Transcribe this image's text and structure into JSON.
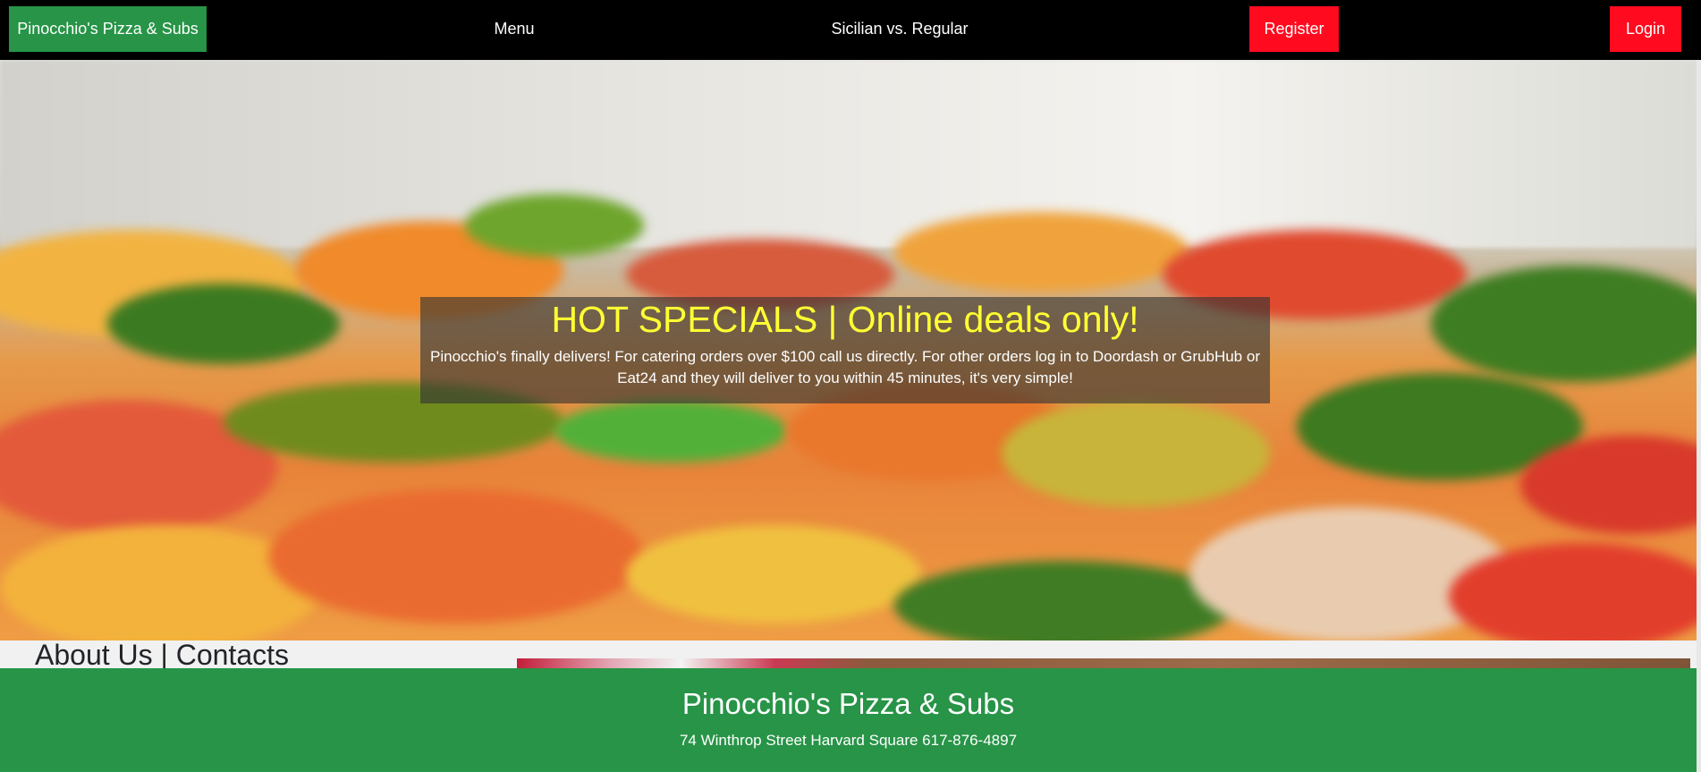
{
  "navbar": {
    "brand_label": "Pinocchio's Pizza & Subs",
    "menu_label": "Menu",
    "sicilian_label": "Sicilian vs. Regular",
    "register_label": "Register",
    "login_label": "Login"
  },
  "hero": {
    "title": "HOT SPECIALS | Online deals only!",
    "text": "Pinocchio's finally delivers! For catering orders over $100 call us directly. For other orders log in to Doordash or GrubHub or Eat24 and they will deliver to you within 45 minutes, it's very simple!"
  },
  "about": {
    "title": "About Us | Contacts"
  },
  "footer": {
    "title": "Pinocchio's Pizza & Subs",
    "address": "74 Winthrop Street Harvard Square 617-876-4897"
  },
  "colors": {
    "brand_green": "#279447",
    "accent_red": "#ff0a1f",
    "nav_black": "#000000",
    "hero_title_yellow": "#ffff33"
  }
}
